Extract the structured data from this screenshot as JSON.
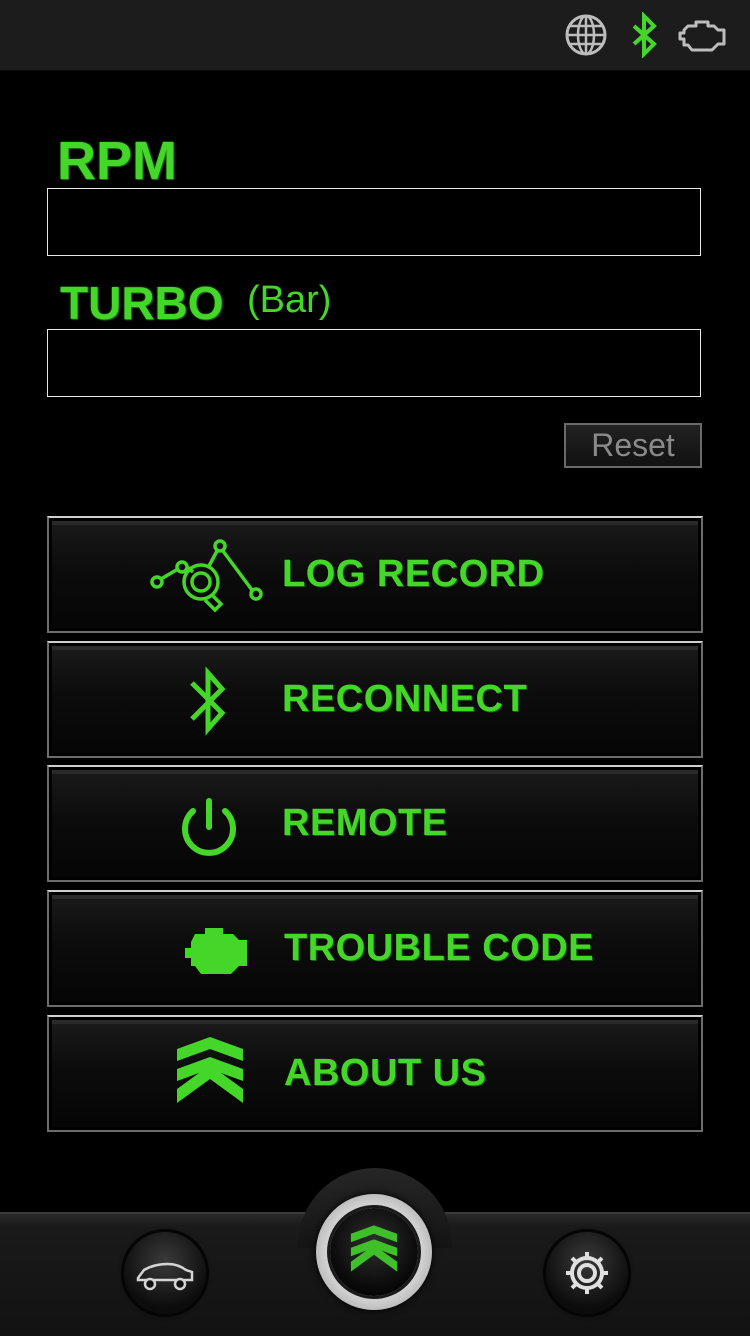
{
  "status_bar": {
    "icons": [
      "globe-icon",
      "bluetooth-icon",
      "engine-icon"
    ],
    "bluetooth_color": "#45d62a"
  },
  "readings": {
    "rpm": {
      "label": "RPM",
      "value": ""
    },
    "turbo": {
      "label": "TURBO",
      "unit": "(Bar)",
      "value": ""
    },
    "reset_label": "Reset"
  },
  "menu": {
    "items": [
      {
        "label": "LOG RECORD",
        "icon": "log-record-icon"
      },
      {
        "label": "RECONNECT",
        "icon": "bluetooth-icon"
      },
      {
        "label": "REMOTE",
        "icon": "power-icon"
      },
      {
        "label": "TROUBLE CODE",
        "icon": "engine-icon"
      },
      {
        "label": "ABOUT US",
        "icon": "brand-logo-icon"
      }
    ]
  },
  "bottom_nav": {
    "items": [
      "car-icon",
      "brand-logo-icon",
      "gear-icon"
    ]
  },
  "colors": {
    "accent": "#45d62a",
    "background": "#000000",
    "bar": "#1c1c1c"
  }
}
